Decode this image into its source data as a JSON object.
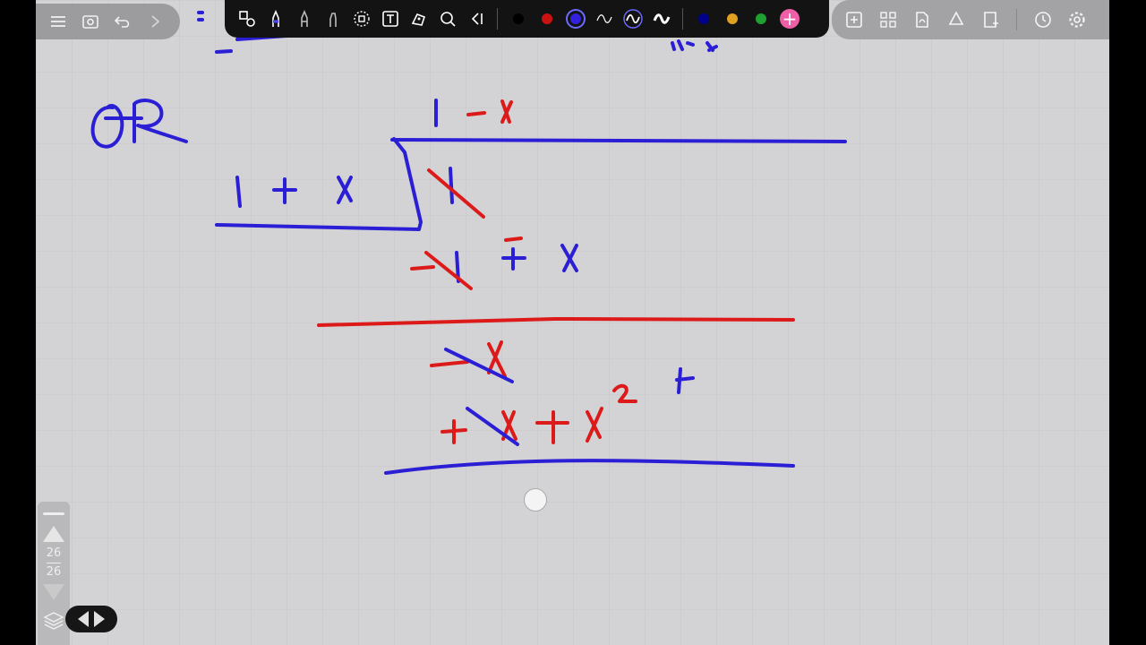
{
  "page_nav": {
    "current": "26",
    "total": "26"
  },
  "colors": {
    "canvas": "#d3d2d4",
    "ink_blue": "#2b1fd6",
    "ink_red": "#dc1a1a",
    "palette": [
      "#000000",
      "#cc1111",
      "#3322dd",
      "#00008b",
      "#e0a020",
      "#20a030"
    ],
    "add_color": "#ef5fa8"
  },
  "toolbar": {
    "left": [
      "menu-icon",
      "camera-icon",
      "undo-icon",
      "redo-icon"
    ],
    "main": [
      "shapes-icon",
      "pen-icon",
      "pencil-icon",
      "highlighter-icon",
      "lasso-icon",
      "text-icon",
      "image-icon",
      "laser-icon",
      "collapse-icon"
    ],
    "right": [
      "add-page-icon",
      "grid-view-icon",
      "pdf-icon",
      "recycle-icon",
      "bookmark-add-icon",
      "clock-icon",
      "gear-icon"
    ]
  }
}
